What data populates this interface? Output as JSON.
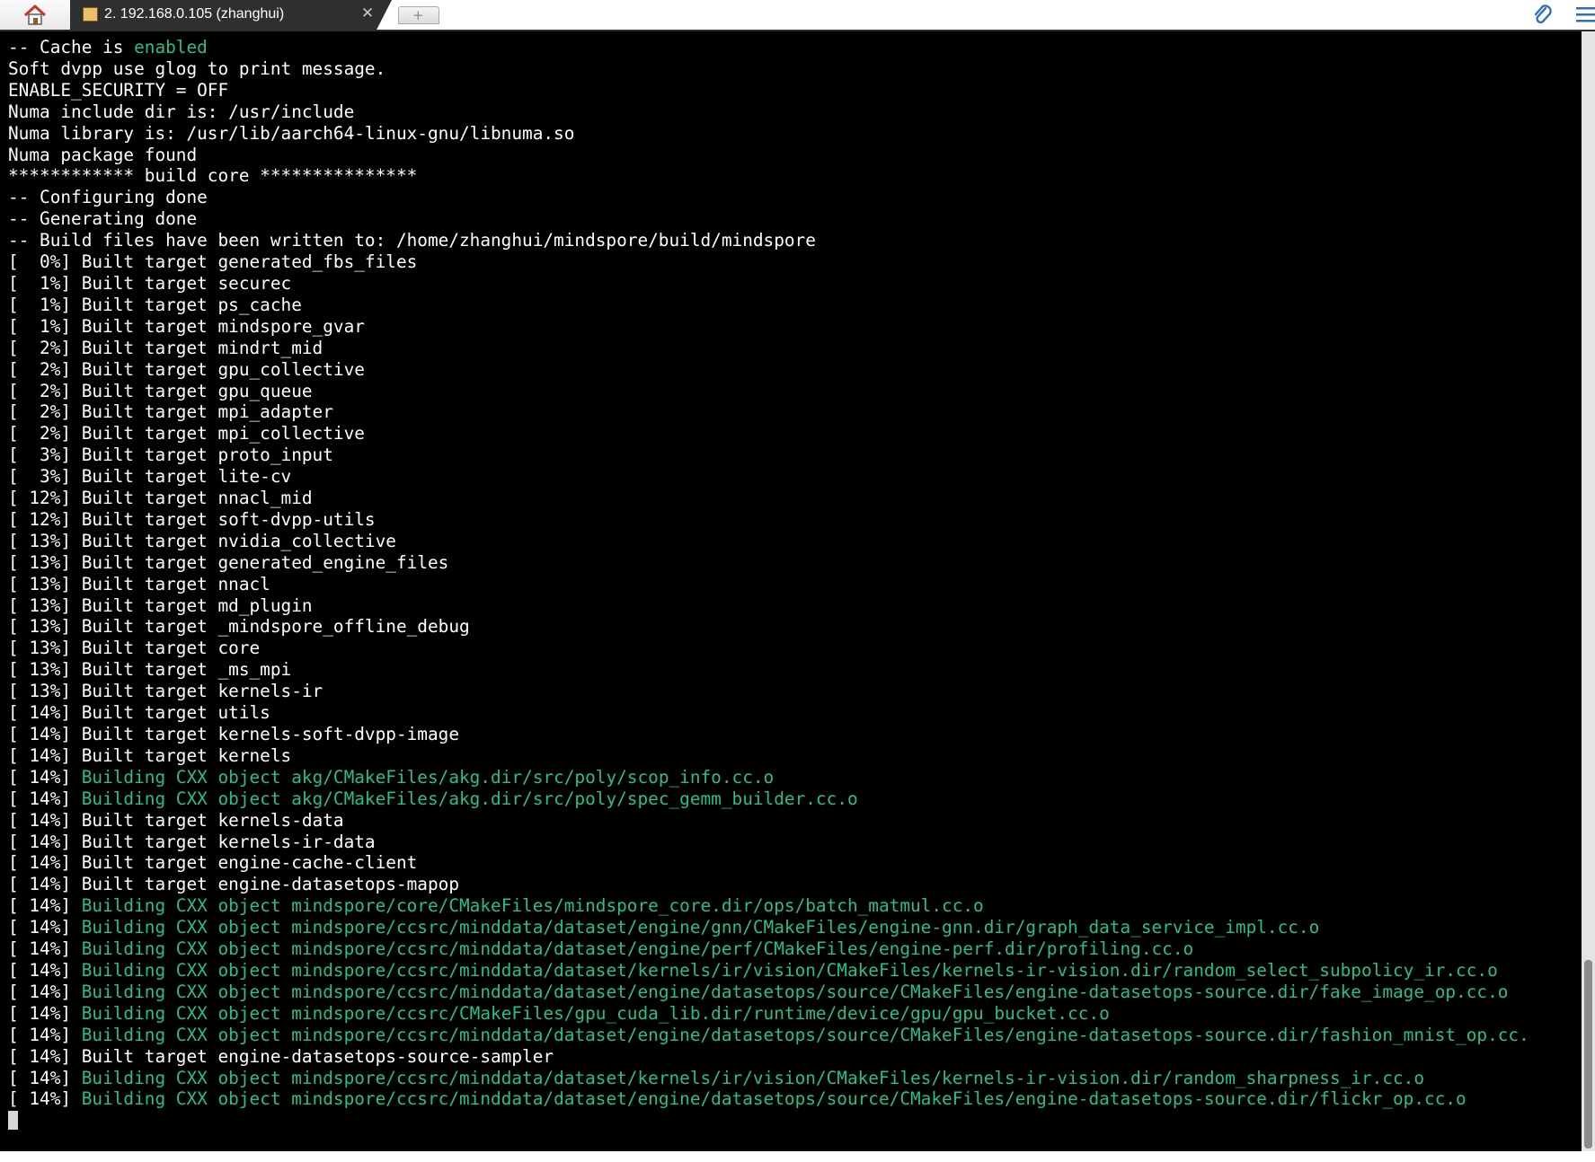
{
  "tab": {
    "home_icon": "home-icon",
    "title": "2. 192.168.0.105 (zhanghui)",
    "close_glyph": "✕",
    "new_tab_glyph": "+"
  },
  "toolbar": {
    "attach_icon": "paperclip-icon",
    "menu_icon": "hamburger-menu-icon"
  },
  "colors": {
    "terminal_bg": "#000000",
    "text_default": "#ffffff",
    "text_green": "#25c08a",
    "tab_active_bg": "#2f2f2f"
  },
  "terminal": {
    "lines": [
      {
        "prefix": "-- Cache is ",
        "highlight": "enabled",
        "suffix": ""
      },
      {
        "prefix": "Soft dvpp use glog to print message.",
        "highlight": "",
        "suffix": ""
      },
      {
        "prefix": "ENABLE_SECURITY = OFF",
        "highlight": "",
        "suffix": ""
      },
      {
        "prefix": "Numa include dir is: /usr/include",
        "highlight": "",
        "suffix": ""
      },
      {
        "prefix": "Numa library is: /usr/lib/aarch64-linux-gnu/libnuma.so",
        "highlight": "",
        "suffix": ""
      },
      {
        "prefix": "Numa package found",
        "highlight": "",
        "suffix": ""
      },
      {
        "prefix": "************ build core ***************",
        "highlight": "",
        "suffix": ""
      },
      {
        "prefix": "-- Configuring done",
        "highlight": "",
        "suffix": ""
      },
      {
        "prefix": "-- Generating done",
        "highlight": "",
        "suffix": ""
      },
      {
        "prefix": "-- Build files have been written to: /home/zhanghui/mindspore/build/mindspore",
        "highlight": "",
        "suffix": ""
      },
      {
        "prefix": "[  0%] Built target generated_fbs_files",
        "highlight": "",
        "suffix": ""
      },
      {
        "prefix": "[  1%] Built target securec",
        "highlight": "",
        "suffix": ""
      },
      {
        "prefix": "[  1%] Built target ps_cache",
        "highlight": "",
        "suffix": ""
      },
      {
        "prefix": "[  1%] Built target mindspore_gvar",
        "highlight": "",
        "suffix": ""
      },
      {
        "prefix": "[  2%] Built target mindrt_mid",
        "highlight": "",
        "suffix": ""
      },
      {
        "prefix": "[  2%] Built target gpu_collective",
        "highlight": "",
        "suffix": ""
      },
      {
        "prefix": "[  2%] Built target gpu_queue",
        "highlight": "",
        "suffix": ""
      },
      {
        "prefix": "[  2%] Built target mpi_adapter",
        "highlight": "",
        "suffix": ""
      },
      {
        "prefix": "[  2%] Built target mpi_collective",
        "highlight": "",
        "suffix": ""
      },
      {
        "prefix": "[  3%] Built target proto_input",
        "highlight": "",
        "suffix": ""
      },
      {
        "prefix": "[  3%] Built target lite-cv",
        "highlight": "",
        "suffix": ""
      },
      {
        "prefix": "[ 12%] Built target nnacl_mid",
        "highlight": "",
        "suffix": ""
      },
      {
        "prefix": "[ 12%] Built target soft-dvpp-utils",
        "highlight": "",
        "suffix": ""
      },
      {
        "prefix": "[ 13%] Built target nvidia_collective",
        "highlight": "",
        "suffix": ""
      },
      {
        "prefix": "[ 13%] Built target generated_engine_files",
        "highlight": "",
        "suffix": ""
      },
      {
        "prefix": "[ 13%] Built target nnacl",
        "highlight": "",
        "suffix": ""
      },
      {
        "prefix": "[ 13%] Built target md_plugin",
        "highlight": "",
        "suffix": ""
      },
      {
        "prefix": "[ 13%] Built target _mindspore_offline_debug",
        "highlight": "",
        "suffix": ""
      },
      {
        "prefix": "[ 13%] Built target core",
        "highlight": "",
        "suffix": ""
      },
      {
        "prefix": "[ 13%] Built target _ms_mpi",
        "highlight": "",
        "suffix": ""
      },
      {
        "prefix": "[ 13%] Built target kernels-ir",
        "highlight": "",
        "suffix": ""
      },
      {
        "prefix": "[ 14%] Built target utils",
        "highlight": "",
        "suffix": ""
      },
      {
        "prefix": "[ 14%] Built target kernels-soft-dvpp-image",
        "highlight": "",
        "suffix": ""
      },
      {
        "prefix": "[ 14%] Built target kernels",
        "highlight": "",
        "suffix": ""
      },
      {
        "prefix": "[ 14%] ",
        "highlight": "Building CXX object akg/CMakeFiles/akg.dir/src/poly/scop_info.cc.o",
        "suffix": ""
      },
      {
        "prefix": "[ 14%] ",
        "highlight": "Building CXX object akg/CMakeFiles/akg.dir/src/poly/spec_gemm_builder.cc.o",
        "suffix": ""
      },
      {
        "prefix": "[ 14%] Built target kernels-data",
        "highlight": "",
        "suffix": ""
      },
      {
        "prefix": "[ 14%] Built target kernels-ir-data",
        "highlight": "",
        "suffix": ""
      },
      {
        "prefix": "[ 14%] Built target engine-cache-client",
        "highlight": "",
        "suffix": ""
      },
      {
        "prefix": "[ 14%] Built target engine-datasetops-mapop",
        "highlight": "",
        "suffix": ""
      },
      {
        "prefix": "[ 14%] ",
        "highlight": "Building CXX object mindspore/core/CMakeFiles/mindspore_core.dir/ops/batch_matmul.cc.o",
        "suffix": ""
      },
      {
        "prefix": "[ 14%] ",
        "highlight": "Building CXX object mindspore/ccsrc/minddata/dataset/engine/gnn/CMakeFiles/engine-gnn.dir/graph_data_service_impl.cc.o",
        "suffix": ""
      },
      {
        "prefix": "[ 14%] ",
        "highlight": "Building CXX object mindspore/ccsrc/minddata/dataset/engine/perf/CMakeFiles/engine-perf.dir/profiling.cc.o",
        "suffix": ""
      },
      {
        "prefix": "[ 14%] ",
        "highlight": "Building CXX object mindspore/ccsrc/minddata/dataset/kernels/ir/vision/CMakeFiles/kernels-ir-vision.dir/random_select_subpolicy_ir.cc.o",
        "suffix": ""
      },
      {
        "prefix": "[ 14%] ",
        "highlight": "Building CXX object mindspore/ccsrc/minddata/dataset/engine/datasetops/source/CMakeFiles/engine-datasetops-source.dir/fake_image_op.cc.o",
        "suffix": ""
      },
      {
        "prefix": "[ 14%] ",
        "highlight": "Building CXX object mindspore/ccsrc/CMakeFiles/gpu_cuda_lib.dir/runtime/device/gpu/gpu_bucket.cc.o",
        "suffix": ""
      },
      {
        "prefix": "[ 14%] ",
        "highlight": "Building CXX object mindspore/ccsrc/minddata/dataset/engine/datasetops/source/CMakeFiles/engine-datasetops-source.dir/fashion_mnist_op.cc.",
        "suffix": ""
      },
      {
        "prefix": "[ 14%] Built target engine-datasetops-source-sampler",
        "highlight": "",
        "suffix": ""
      },
      {
        "prefix": "[ 14%] ",
        "highlight": "Building CXX object mindspore/ccsrc/minddata/dataset/kernels/ir/vision/CMakeFiles/kernels-ir-vision.dir/random_sharpness_ir.cc.o",
        "suffix": ""
      },
      {
        "prefix": "[ 14%] ",
        "highlight": "Building CXX object mindspore/ccsrc/minddata/dataset/engine/datasetops/source/CMakeFiles/engine-datasetops-source.dir/flickr_op.cc.o",
        "suffix": ""
      }
    ]
  }
}
